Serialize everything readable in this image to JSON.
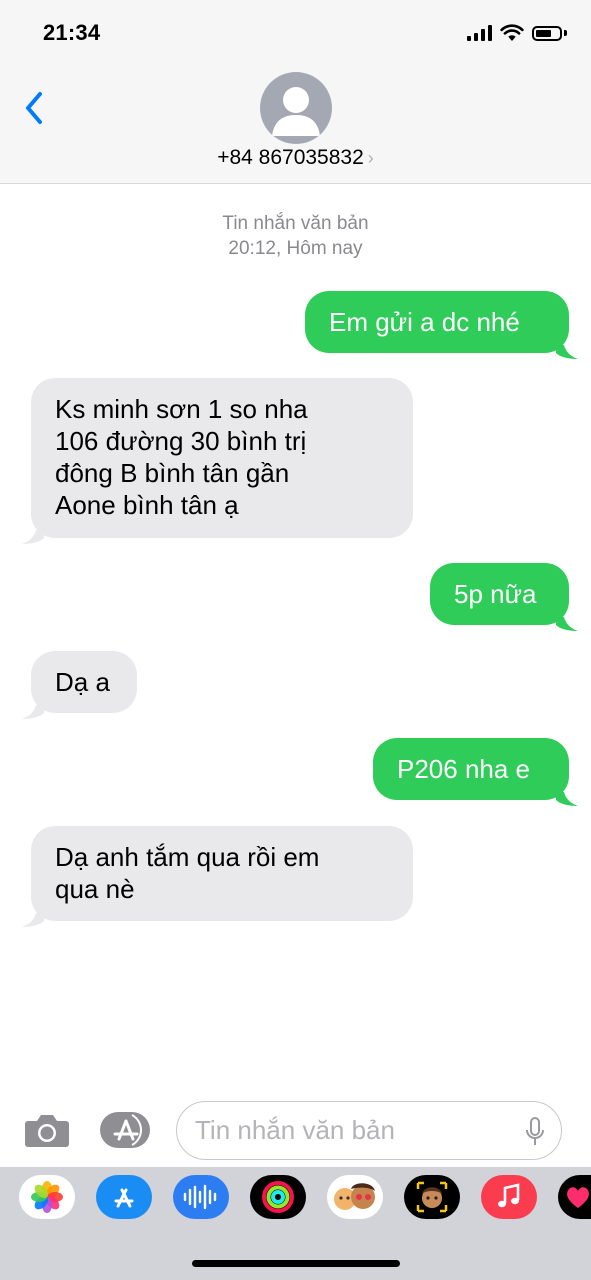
{
  "status": {
    "time": "21:34"
  },
  "header": {
    "contact": "+84 867035832",
    "chevron": "›"
  },
  "thread": {
    "meta_type": "Tin nhắn văn bản",
    "meta_time": "20:12, Hôm nay",
    "messages": [
      {
        "dir": "out",
        "lines": [
          "Em gửi a dc nhé"
        ]
      },
      {
        "dir": "in",
        "lines": [
          "Ks minh sơn 1 so nha",
          "106 đường 30 bình trị",
          "đông B bình tân gần",
          "Aone bình tân ạ"
        ]
      },
      {
        "dir": "out",
        "lines": [
          "5p nữa"
        ]
      },
      {
        "dir": "in",
        "lines": [
          "Dạ a"
        ]
      },
      {
        "dir": "out",
        "lines": [
          "P206 nha e"
        ]
      },
      {
        "dir": "in",
        "lines": [
          "Dạ anh tắm qua rồi em",
          "qua nè"
        ]
      }
    ]
  },
  "composer": {
    "placeholder": "Tin nhắn văn bản"
  },
  "colors": {
    "outgoing": "#2fcc59",
    "incoming": "#e9e9eb",
    "accent": "#007aff"
  },
  "app_drawer": [
    "photos-icon",
    "app-store-icon",
    "audio-icon",
    "activity-icon",
    "memoji-stickers-icon",
    "memoji-icon",
    "music-icon",
    "digital-touch-icon"
  ]
}
